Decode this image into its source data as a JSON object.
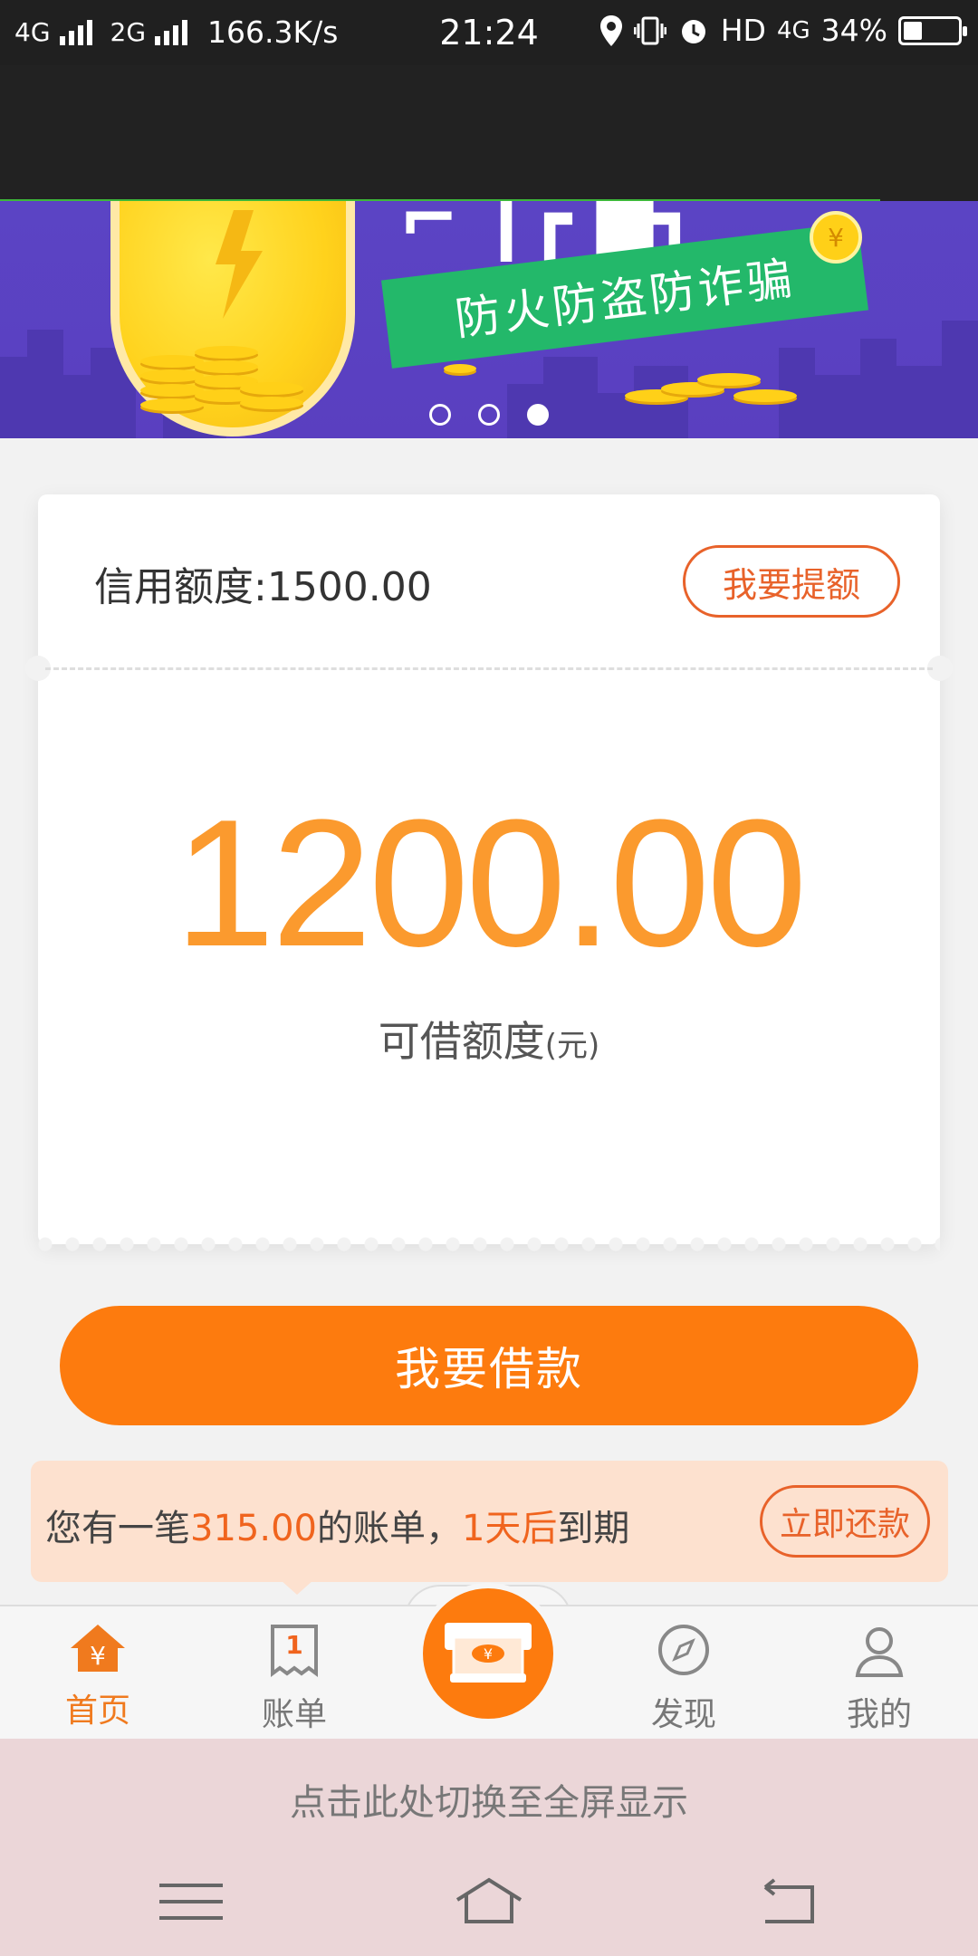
{
  "status_bar": {
    "network1": "4G",
    "network2": "2G",
    "speed": "166.3K/s",
    "time": "21:24",
    "hd": "HD",
    "network3": "4G",
    "battery": "34%"
  },
  "banner": {
    "headline": "防火防盗防诈骗",
    "slide_count": 3,
    "active_slide": 3
  },
  "credit": {
    "label": "信用额度:1500.00",
    "raise_button": "我要提额",
    "available_amount": "1200.00",
    "available_label": "可借额度",
    "available_unit": "(元)"
  },
  "borrow_button": "我要借款",
  "bill": {
    "prefix": "您有一笔",
    "amount": "315.00",
    "middle": "的账单，",
    "due": "1天后",
    "suffix": "到期",
    "repay_button": "立即还款"
  },
  "tabbar": {
    "home": "首页",
    "bills": "账单",
    "bills_badge": "1",
    "discover": "发现",
    "mine": "我的",
    "center_icon": "yen-cash-icon"
  },
  "fullscreen_hint": "点击此处切换至全屏显示",
  "colors": {
    "accent": "#fd7b0e",
    "amount": "#fb9a2e",
    "bill_bg": "#fde1cf",
    "banner_bg": "#5b44c4"
  }
}
